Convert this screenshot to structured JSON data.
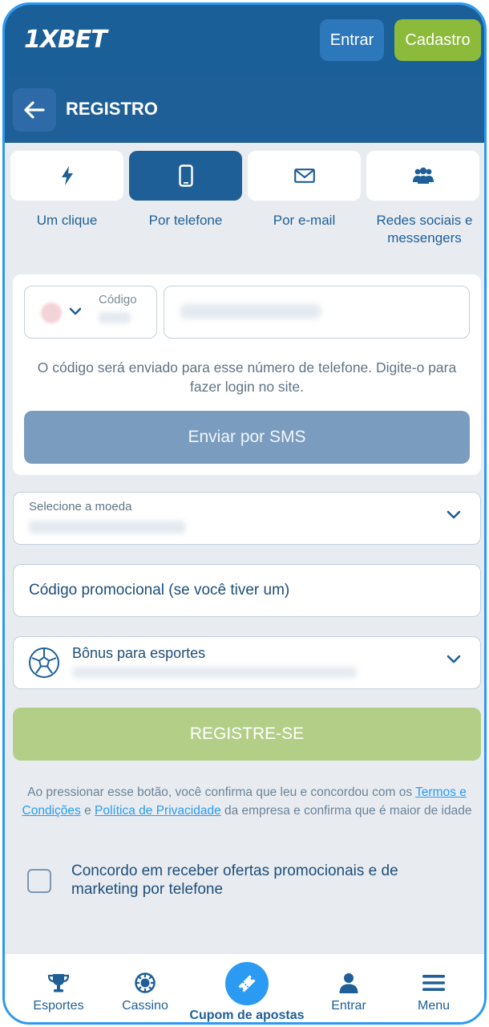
{
  "header": {
    "logo_prefix": "1X",
    "logo_suffix": "BET",
    "login_label": "Entrar",
    "signup_label": "Cadastro"
  },
  "titlebar": {
    "title": "REGISTRO"
  },
  "tabs": [
    {
      "label": "Um clique",
      "icon": "lightning-icon",
      "active": false
    },
    {
      "label": "Por telefone",
      "icon": "phone-icon",
      "active": true
    },
    {
      "label": "Por e-mail",
      "icon": "envelope-icon",
      "active": false
    },
    {
      "label": "Redes sociais e messengers",
      "icon": "people-icon",
      "active": false
    }
  ],
  "phone_form": {
    "code_label": "Código",
    "sms_note": "O código será enviado para esse número de telefone. Digite-o para fazer login no site.",
    "send_sms_label": "Enviar por SMS"
  },
  "currency": {
    "label": "Selecione a moeda"
  },
  "promo": {
    "placeholder": "Código promocional (se você tiver um)"
  },
  "bonus": {
    "title": "Bônus para esportes"
  },
  "register": {
    "label": "REGISTRE-SE"
  },
  "terms": {
    "prefix": "Ao pressionar esse botão, você confirma que leu e concordou com os ",
    "terms_link": "Termos e Condições",
    "and": " e ",
    "privacy_link": "Política de Privacidade",
    "suffix": " da empresa e confirma que é maior de idade"
  },
  "consent": {
    "text": "Concordo em receber ofertas promocionais e de marketing por telefone"
  },
  "bottom_nav": {
    "sports": "Esportes",
    "casino": "Cassino",
    "coupon": "Cupom de apostas",
    "login": "Entrar",
    "menu": "Menu"
  },
  "colors": {
    "header_bg": "#1b5f99",
    "accent_blue": "#2b9af3",
    "signup_green": "#8cba3a",
    "register_green_disabled": "#b3cf87",
    "sms_disabled": "#7a9cbf",
    "page_bg": "#e8ecf1"
  }
}
